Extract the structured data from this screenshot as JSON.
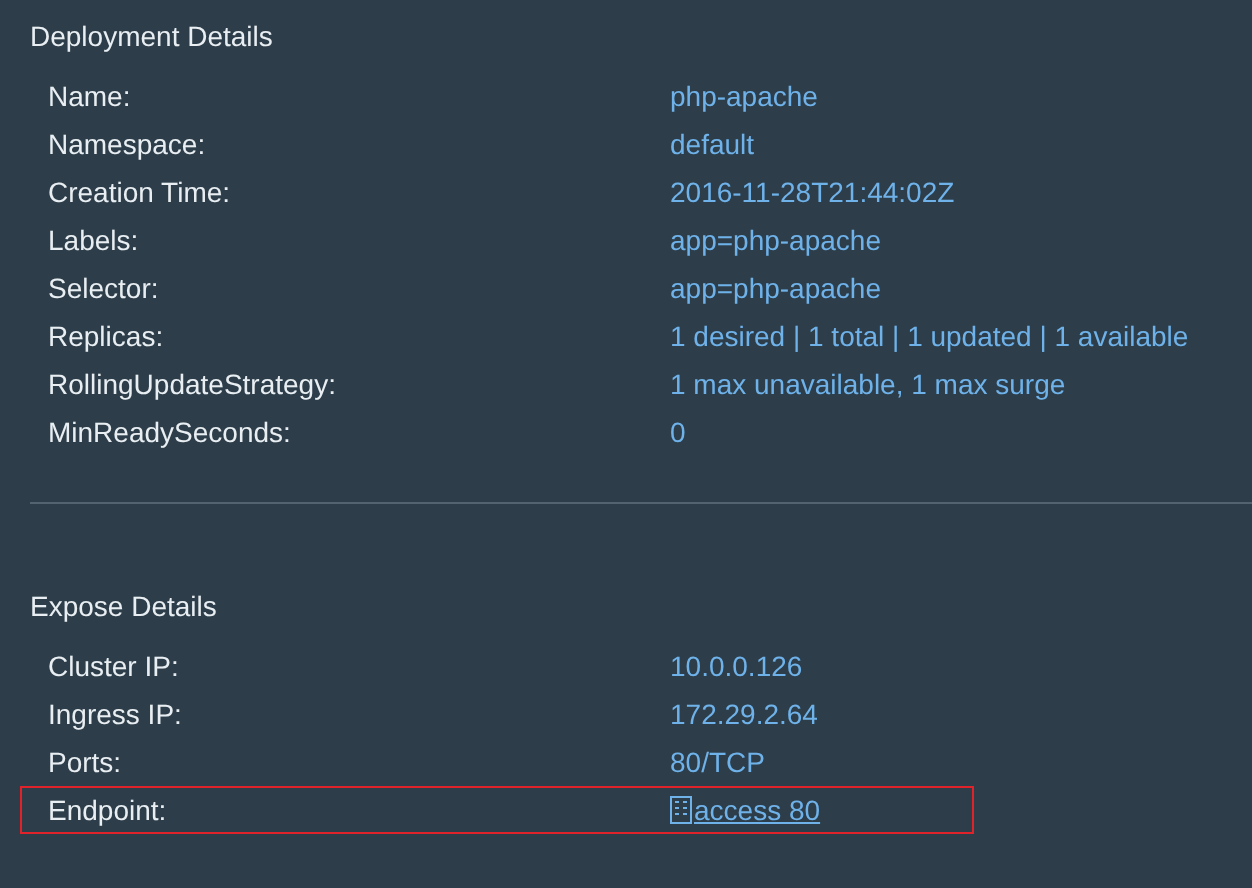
{
  "sections": [
    {
      "title": "Deployment Details",
      "rows": [
        {
          "label": "Name:",
          "value": "php-apache",
          "kind": "text",
          "highlighted": false
        },
        {
          "label": "Namespace:",
          "value": "default",
          "kind": "text",
          "highlighted": false
        },
        {
          "label": "Creation Time:",
          "value": "2016-11-28T21:44:02Z",
          "kind": "text",
          "highlighted": false
        },
        {
          "label": "Labels:",
          "value": "app=php-apache",
          "kind": "text",
          "highlighted": false
        },
        {
          "label": "Selector:",
          "value": "app=php-apache",
          "kind": "text",
          "highlighted": false
        },
        {
          "label": "Replicas:",
          "value": "1 desired | 1 total | 1 updated | 1 available",
          "kind": "text",
          "highlighted": false
        },
        {
          "label": "RollingUpdateStrategy:",
          "value": "1 max unavailable, 1 max surge",
          "kind": "text",
          "highlighted": false
        },
        {
          "label": "MinReadySeconds:",
          "value": "0",
          "kind": "text",
          "highlighted": false
        }
      ]
    },
    {
      "title": "Expose Details",
      "rows": [
        {
          "label": "Cluster IP:",
          "value": "10.0.0.126",
          "kind": "text",
          "highlighted": false
        },
        {
          "label": "Ingress IP:",
          "value": "172.29.2.64",
          "kind": "text",
          "highlighted": false
        },
        {
          "label": "Ports:",
          "value": "80/TCP",
          "kind": "text",
          "highlighted": false
        },
        {
          "label": "Endpoint:",
          "value": "access 80",
          "kind": "link",
          "highlighted": true
        }
      ]
    }
  ]
}
